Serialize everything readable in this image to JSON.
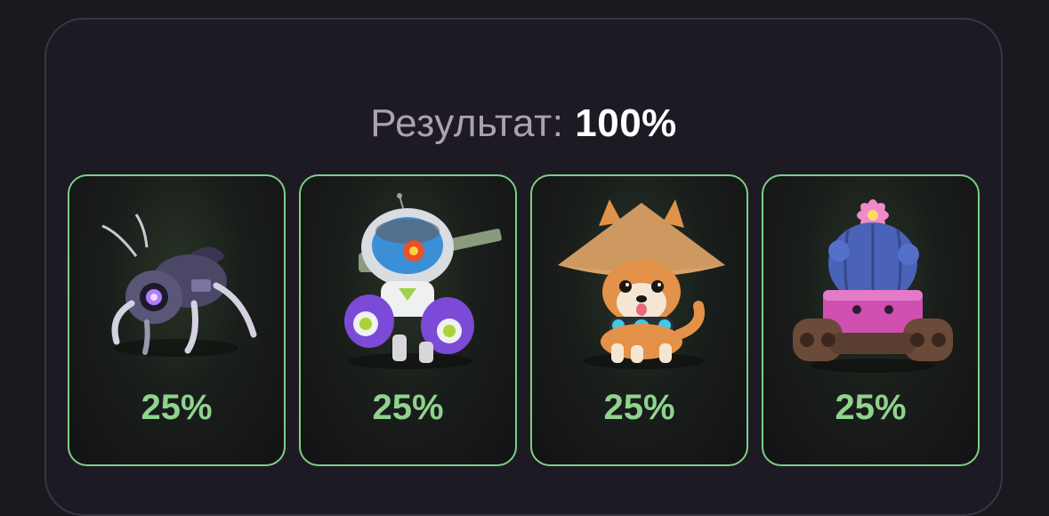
{
  "result": {
    "label": "Результат:",
    "value": "100%"
  },
  "cards": [
    {
      "name": "robot-spider",
      "percent": "25%"
    },
    {
      "name": "astronaut-fish-mech",
      "percent": "25%"
    },
    {
      "name": "shiba-dog-hat",
      "percent": "25%"
    },
    {
      "name": "cactus-tank",
      "percent": "25%"
    }
  ],
  "colors": {
    "accent_border": "#7ccf86",
    "percent_text": "#8fd38e",
    "background": "#1b1820",
    "panel_border": "#3a3640"
  }
}
